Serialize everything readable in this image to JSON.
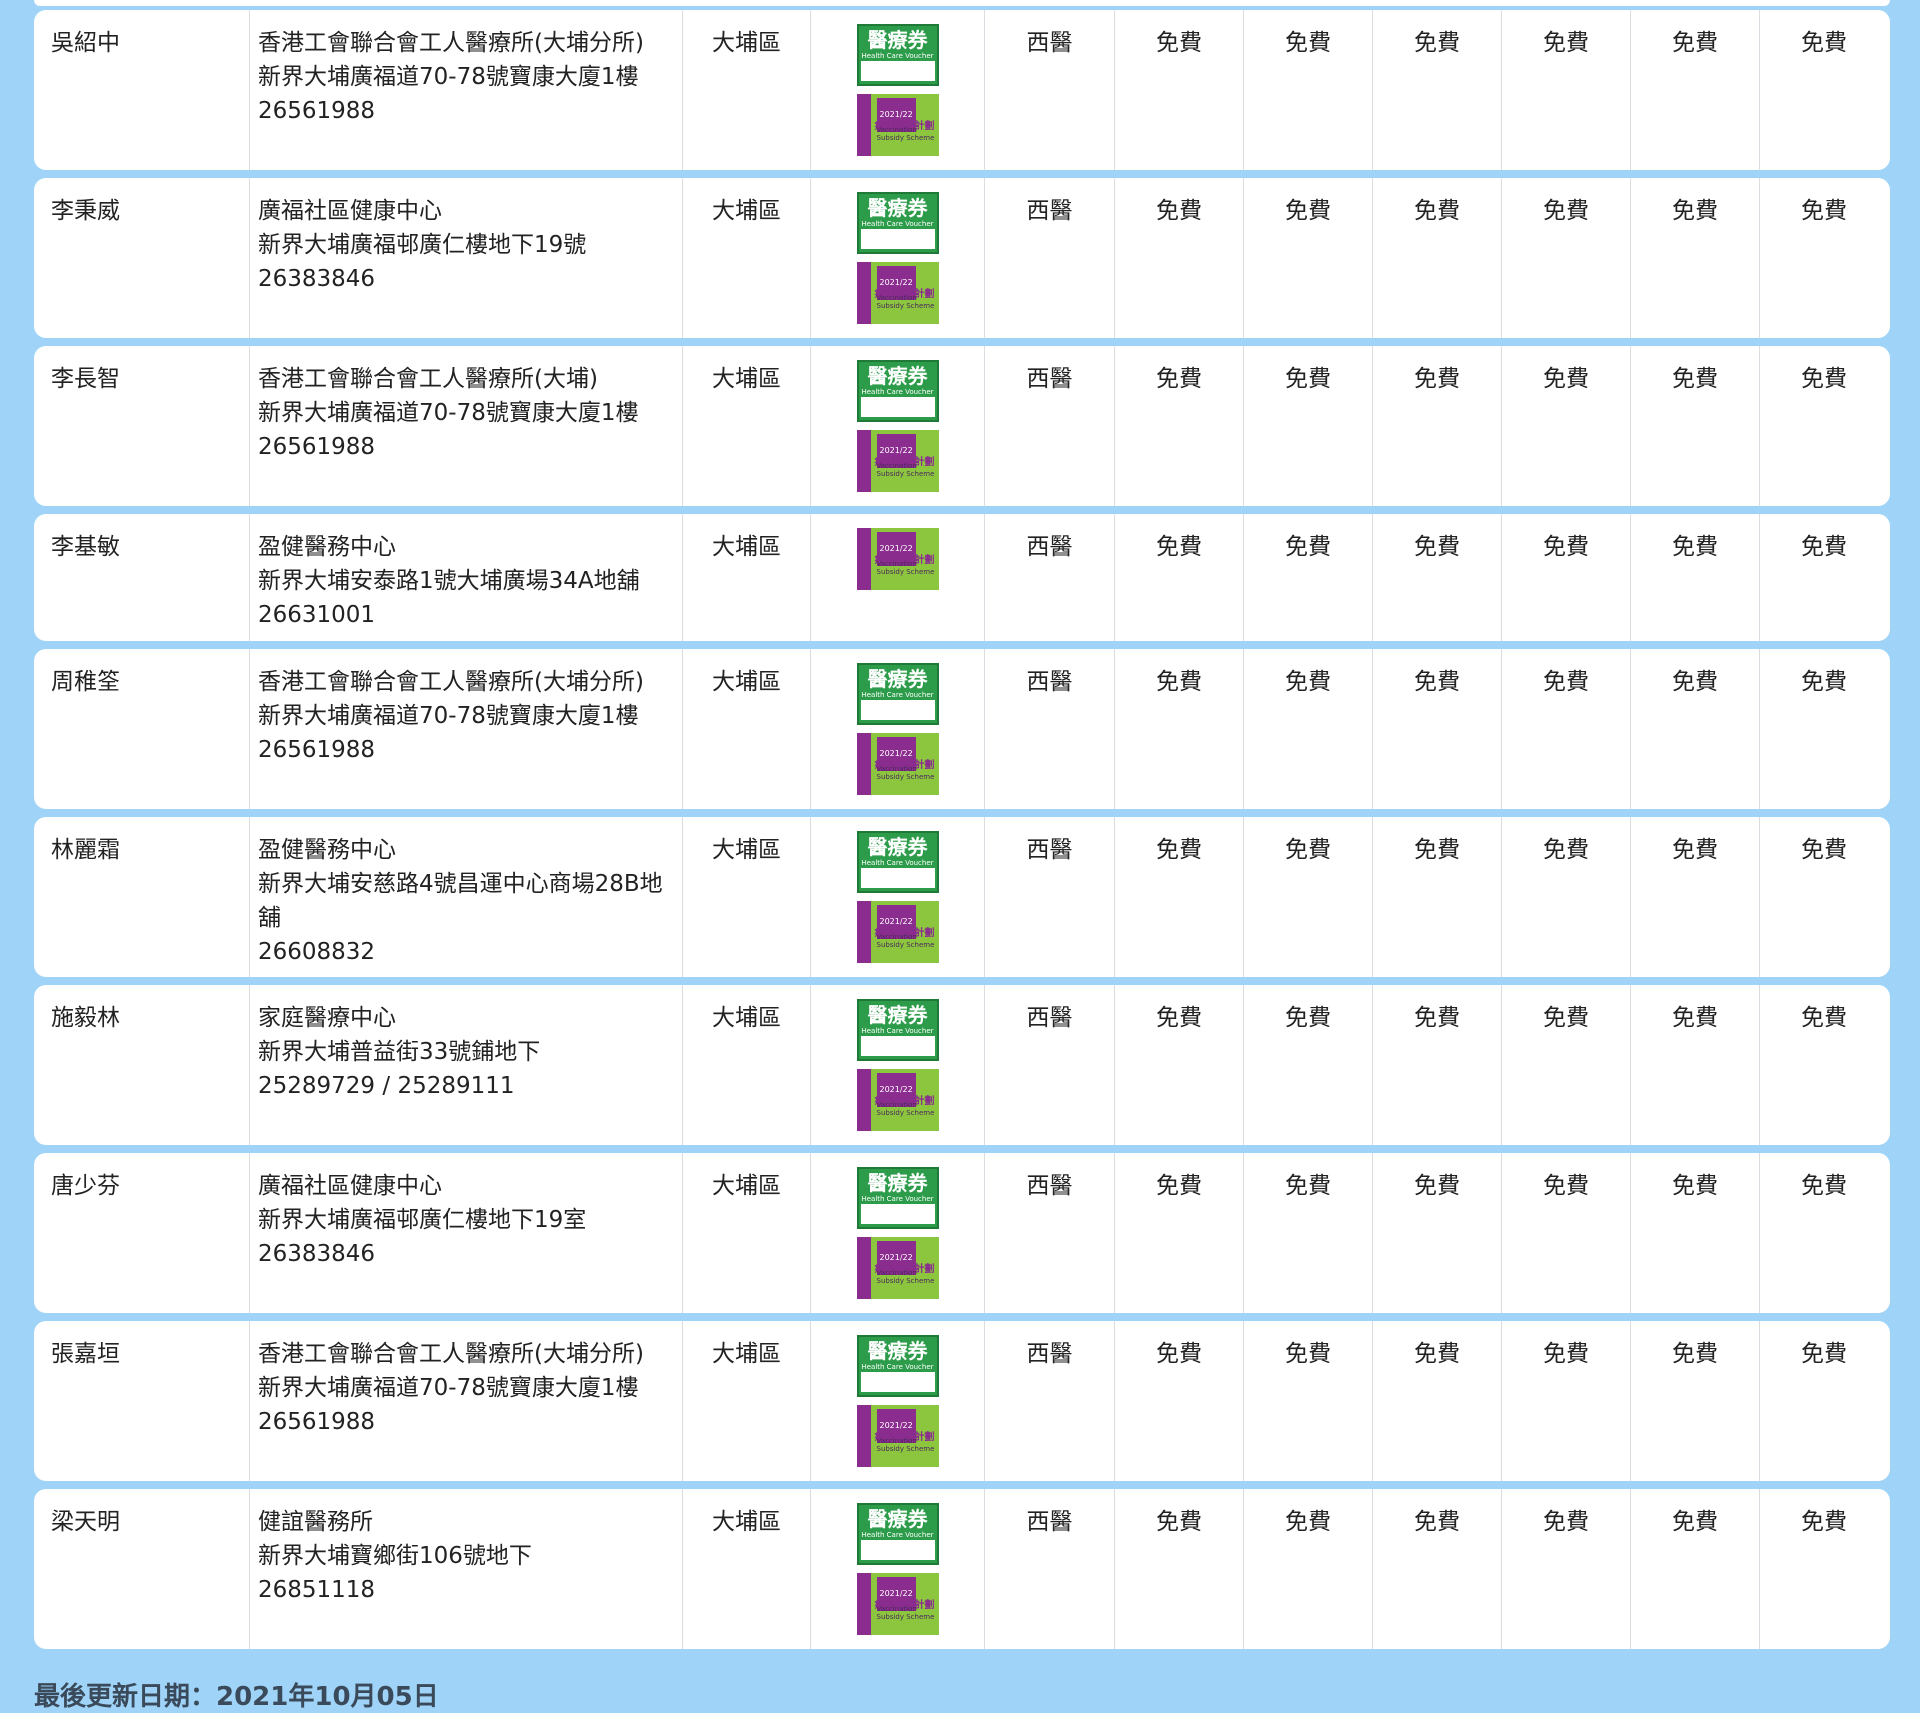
{
  "footer": {
    "last_updated": "最後更新日期：2021年10月05日"
  },
  "icons": {
    "voucher_cn": "醫療券",
    "voucher_en": "Health Care Voucher",
    "vss_year": "2021/22",
    "vss_cn": "疫苗資助計劃",
    "vss_en": "Vaccination Subsidy Scheme"
  },
  "doctors": [
    {
      "name": "吳紹中",
      "clinic": "香港工會聯合會工人醫療所(大埔分所)",
      "address": "新界大埔廣福道70-78號寶康大廈1樓",
      "phone": "26561988",
      "district": "大埔區",
      "voucher": true,
      "type": "西醫",
      "fees": [
        "免費",
        "免費",
        "免費",
        "免費",
        "免費",
        "免費"
      ]
    },
    {
      "name": "李秉威",
      "clinic": "廣福社區健康中心",
      "address": "新界大埔廣福邨廣仁樓地下19號",
      "phone": "26383846",
      "district": "大埔區",
      "voucher": true,
      "type": "西醫",
      "fees": [
        "免費",
        "免費",
        "免費",
        "免費",
        "免費",
        "免費"
      ]
    },
    {
      "name": "李長智",
      "clinic": "香港工會聯合會工人醫療所(大埔)",
      "address": "新界大埔廣福道70-78號寶康大廈1樓",
      "phone": "26561988",
      "district": "大埔區",
      "voucher": true,
      "type": "西醫",
      "fees": [
        "免費",
        "免費",
        "免費",
        "免費",
        "免費",
        "免費"
      ]
    },
    {
      "name": "李基敏",
      "clinic": "盈健醫務中心",
      "address": "新界大埔安泰路1號大埔廣場34A地舖",
      "phone": "26631001",
      "district": "大埔區",
      "voucher": false,
      "type": "西醫",
      "fees": [
        "免費",
        "免費",
        "免費",
        "免費",
        "免費",
        "免費"
      ]
    },
    {
      "name": "周稚筌",
      "clinic": "香港工會聯合會工人醫療所(大埔分所)",
      "address": "新界大埔廣福道70-78號寶康大廈1樓",
      "phone": "26561988",
      "district": "大埔區",
      "voucher": true,
      "type": "西醫",
      "fees": [
        "免費",
        "免費",
        "免費",
        "免費",
        "免費",
        "免費"
      ]
    },
    {
      "name": "林麗霜",
      "clinic": "盈健醫務中心",
      "address": "新界大埔安慈路4號昌運中心商場28B地舖",
      "phone": "26608832",
      "district": "大埔區",
      "voucher": true,
      "type": "西醫",
      "fees": [
        "免費",
        "免費",
        "免費",
        "免費",
        "免費",
        "免費"
      ]
    },
    {
      "name": "施毅林",
      "clinic": "家庭醫療中心",
      "address": "新界大埔普益街33號鋪地下",
      "phone": "25289729 / 25289111",
      "district": "大埔區",
      "voucher": true,
      "type": "西醫",
      "fees": [
        "免費",
        "免費",
        "免費",
        "免費",
        "免費",
        "免費"
      ]
    },
    {
      "name": "唐少芬",
      "clinic": "廣福社區健康中心",
      "address": "新界大埔廣福邨廣仁樓地下19室",
      "phone": "26383846",
      "district": "大埔區",
      "voucher": true,
      "type": "西醫",
      "fees": [
        "免費",
        "免費",
        "免費",
        "免費",
        "免費",
        "免費"
      ]
    },
    {
      "name": "張嘉垣",
      "clinic": "香港工會聯合會工人醫療所(大埔分所)",
      "address": "新界大埔廣福道70-78號寶康大廈1樓",
      "phone": "26561988",
      "district": "大埔區",
      "voucher": true,
      "type": "西醫",
      "fees": [
        "免費",
        "免費",
        "免費",
        "免費",
        "免費",
        "免費"
      ]
    },
    {
      "name": "梁天明",
      "clinic": "健誼醫務所",
      "address": "新界大埔寶鄉街106號地下",
      "phone": "26851118",
      "district": "大埔區",
      "voucher": true,
      "type": "西醫",
      "fees": [
        "免費",
        "免費",
        "免費",
        "免費",
        "免費",
        "免費"
      ]
    }
  ]
}
